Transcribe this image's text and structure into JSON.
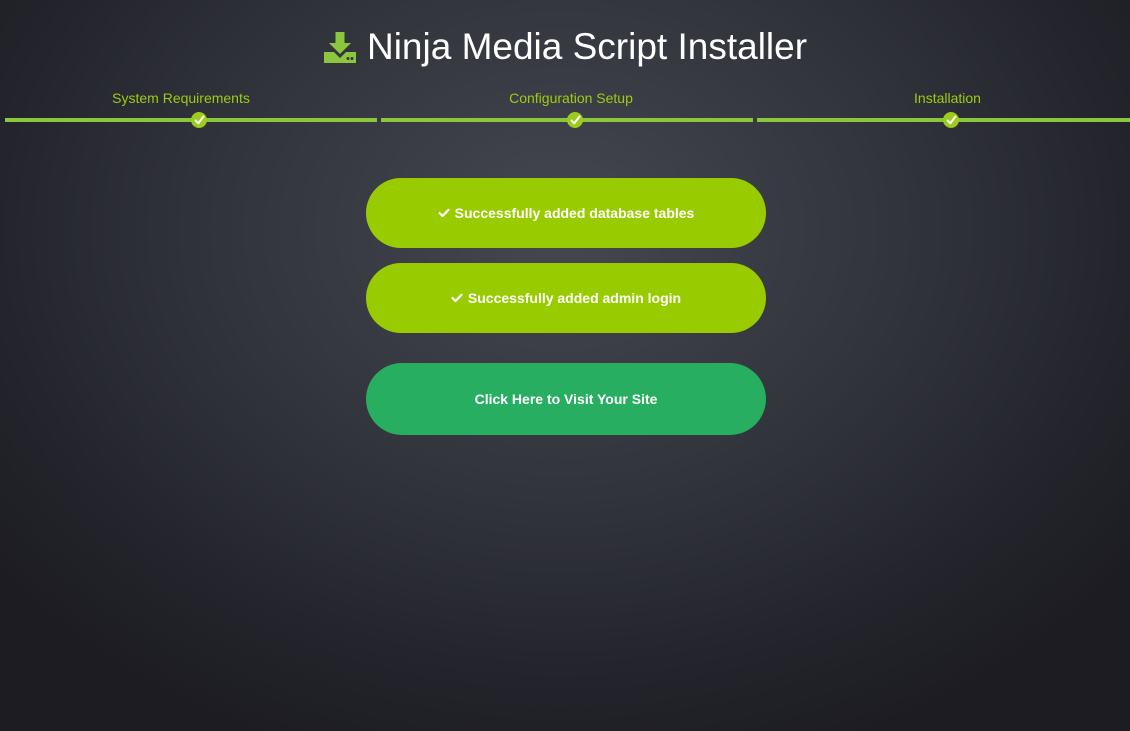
{
  "header": {
    "title": "Ninja Media Script Installer",
    "icon": "download-icon"
  },
  "steps": [
    {
      "label": "System Requirements",
      "status": "complete",
      "icon": "check-icon"
    },
    {
      "label": "Configuration Setup",
      "status": "complete",
      "icon": "check-icon"
    },
    {
      "label": "Installation",
      "status": "complete",
      "icon": "check-icon"
    }
  ],
  "messages": [
    {
      "text": "Successfully added database tables",
      "icon": "check-icon"
    },
    {
      "text": "Successfully added admin login",
      "icon": "check-icon"
    }
  ],
  "visit_button": {
    "label": "Click Here to Visit Your Site"
  },
  "colors": {
    "accent": "#99cc00",
    "step_line": "#8cc63f",
    "visit_button": "#27ae60",
    "background": "#33353d"
  }
}
